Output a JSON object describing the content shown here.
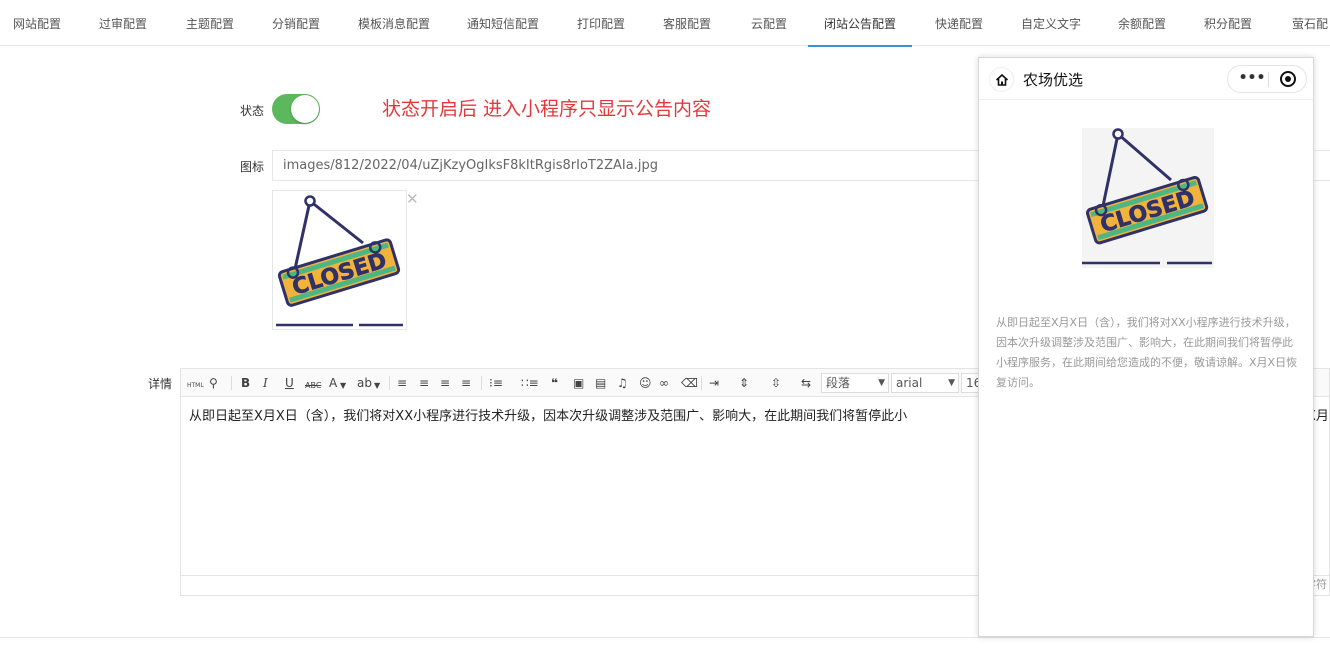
{
  "tabs": [
    {
      "label": "网站配置"
    },
    {
      "label": "过审配置"
    },
    {
      "label": "主题配置"
    },
    {
      "label": "分销配置"
    },
    {
      "label": "模板消息配置"
    },
    {
      "label": "通知短信配置"
    },
    {
      "label": "打印配置"
    },
    {
      "label": "客服配置"
    },
    {
      "label": "云配置"
    },
    {
      "label": "闭站公告配置"
    },
    {
      "label": "快递配置"
    },
    {
      "label": "自定义文字"
    },
    {
      "label": "余额配置"
    },
    {
      "label": "积分配置"
    },
    {
      "label": "萤石配"
    }
  ],
  "active_tab": "闭站公告配置",
  "form": {
    "status_label": "状态",
    "status_on": true,
    "status_hint": "状态开启后 进入小程序只显示公告内容",
    "icon_label": "图标",
    "icon_path": "images/812/2022/04/uZjKzyOgIksF8kItRgis8rIoT2ZAIa.jpg",
    "image_text": "CLOSED",
    "remove_glyph": "✕",
    "detail_label": "详情"
  },
  "editor": {
    "toolbar": {
      "html": "HTML",
      "bold": "B",
      "italic": "I",
      "underline": "U",
      "strike": "ABC",
      "fontcolor": "A",
      "paragraph": "段落",
      "font": "arial",
      "size": "16"
    },
    "content": "从即日起至X月X日（含），我们将对XX小程序进行技术升级，因本次升级调整涉及范围广、影响大，在此期间我们将暂停此小",
    "content_tail": "X月",
    "word_count": "字符"
  },
  "preview": {
    "title": "农场优选",
    "image_text": "CLOSED",
    "notice": "从即日起至X月X日（含），我们将对XX小程序进行技术升级，因本次升级调整涉及范围广、影响大，在此期间我们将暂停此小程序服务，在此期间给您造成的不便，敬请谅解。X月X日恢复访问。",
    "menu_glyph": "•••"
  },
  "colors": {
    "toggle_on": "#5cb85c",
    "hint": "#e4393c",
    "active_tab": "#3b8fd6",
    "sign_yellow": "#f2b33d",
    "sign_navy": "#2f3168",
    "sign_green": "#4db783"
  }
}
